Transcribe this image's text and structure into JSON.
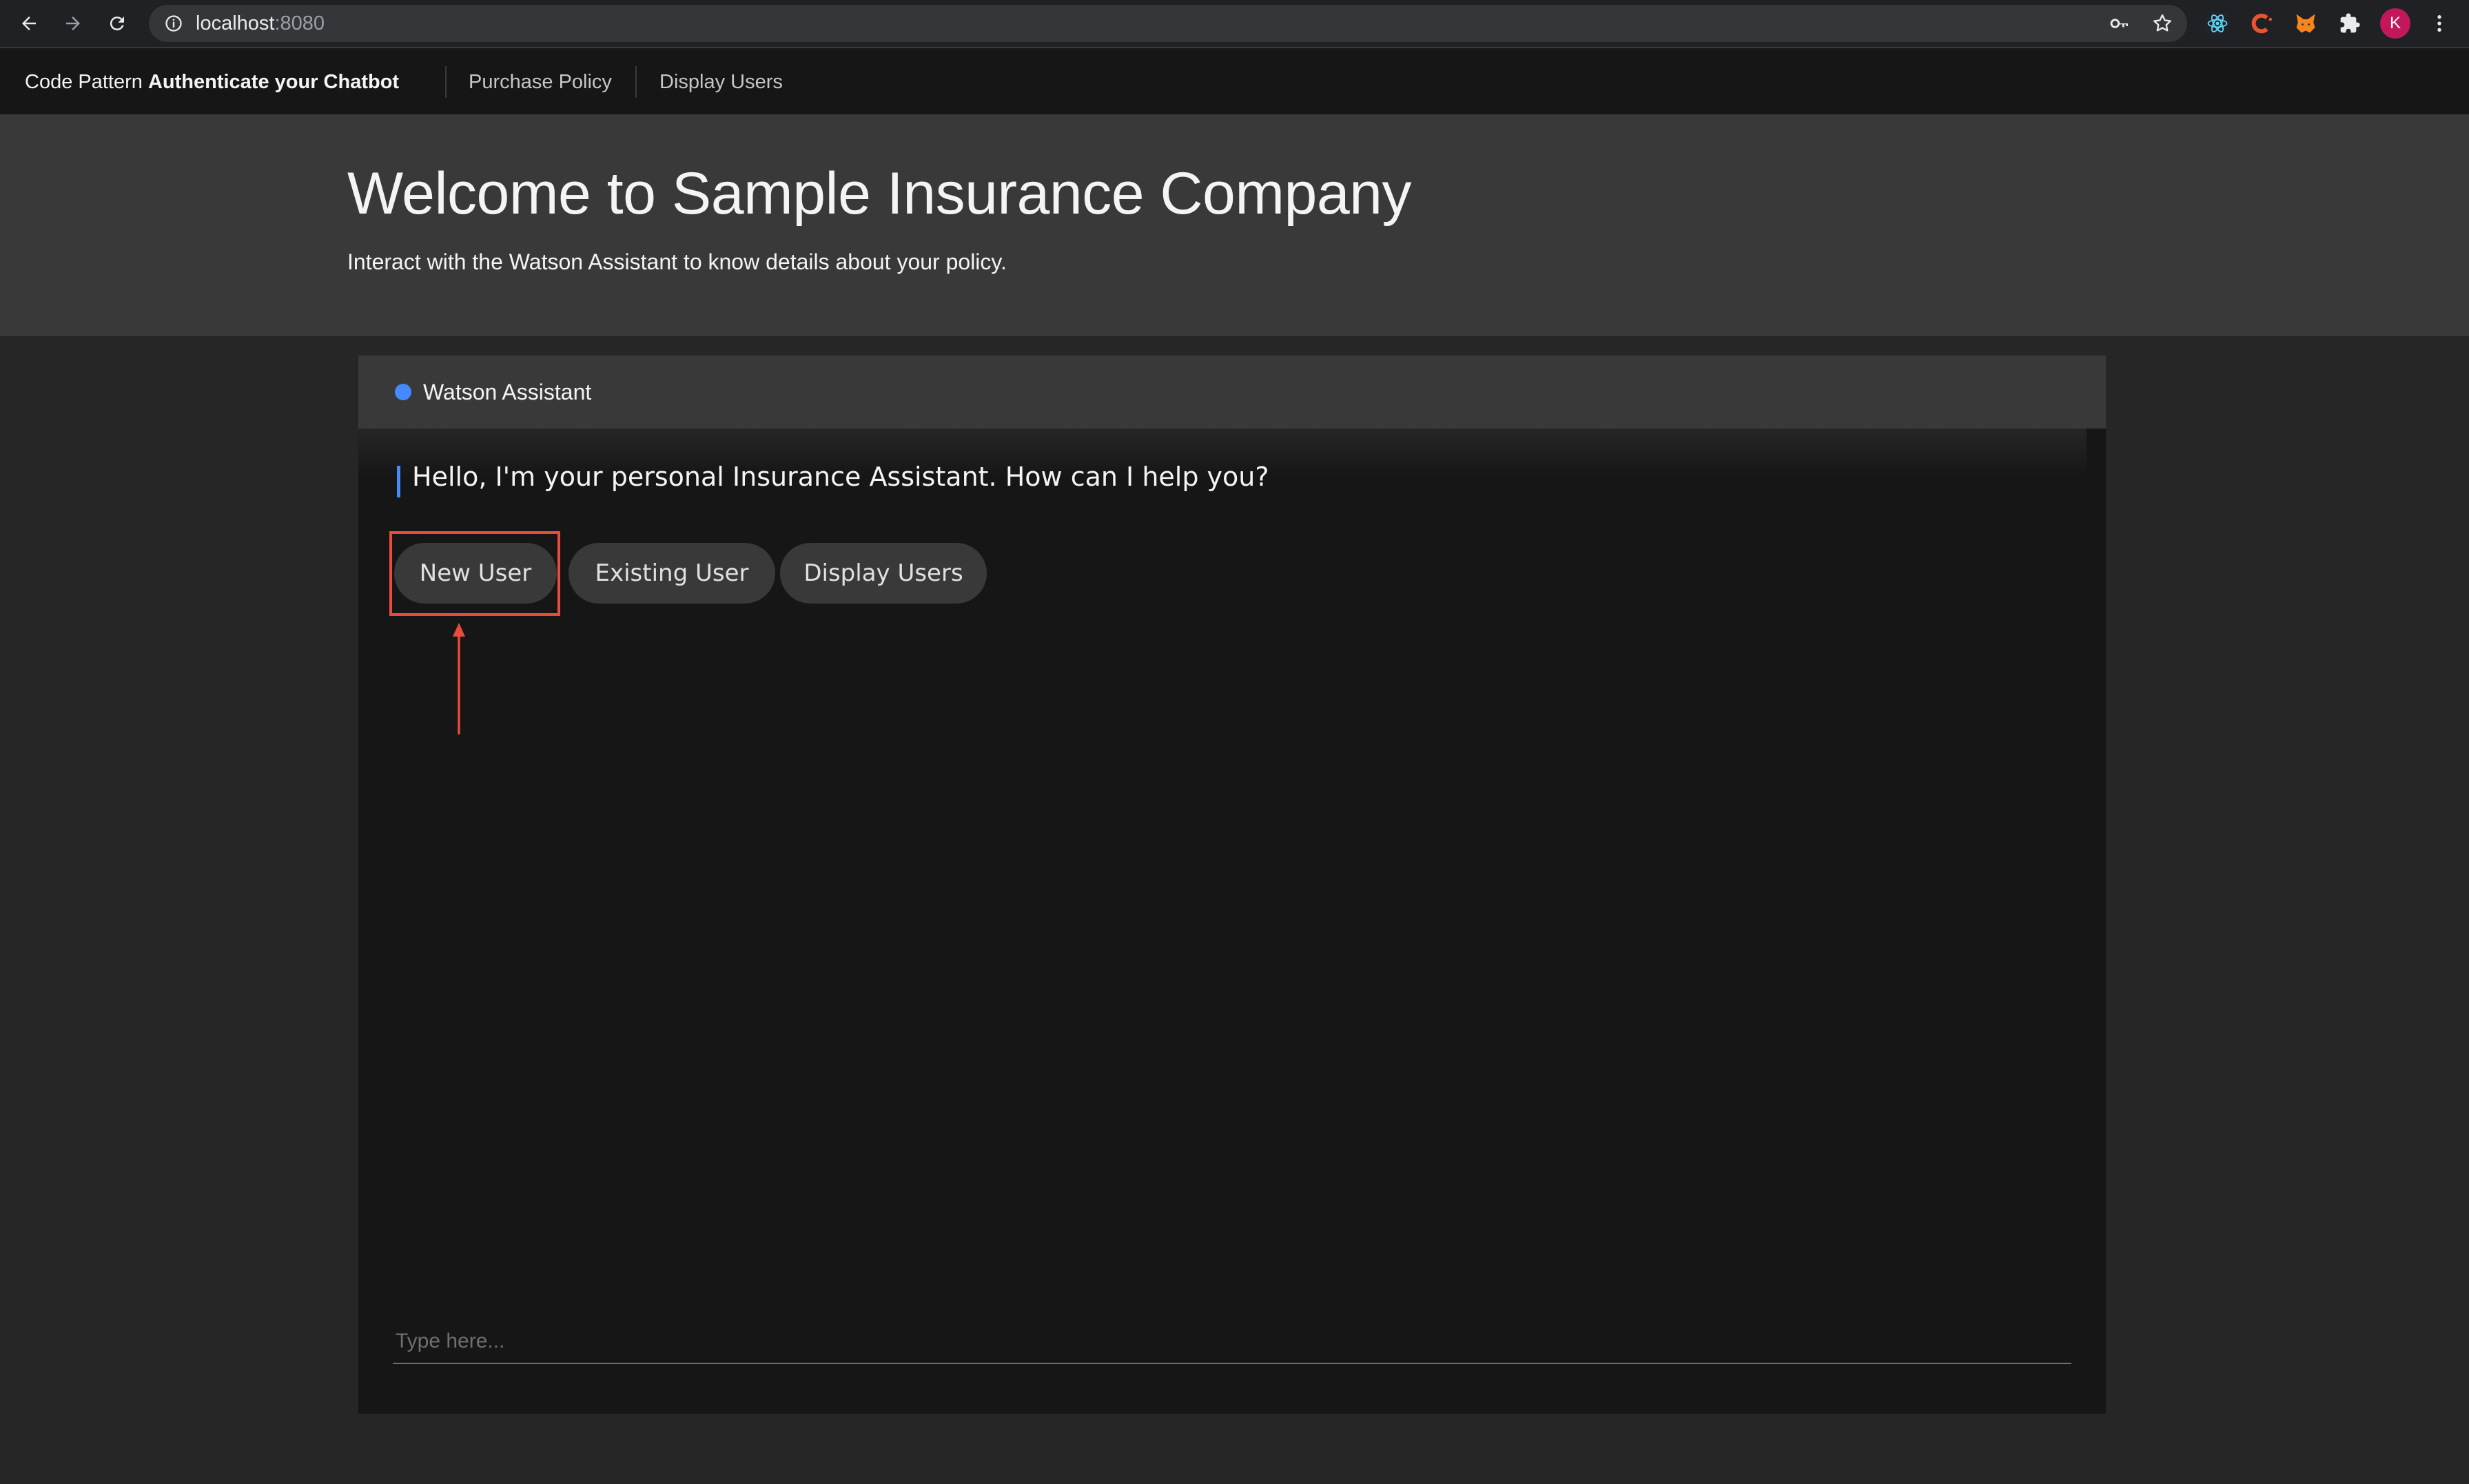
{
  "browser": {
    "url_host": "localhost",
    "url_port": ":8080",
    "profile_initial": "K"
  },
  "header": {
    "brand_prefix": "Code Pattern ",
    "brand_bold": "Authenticate your Chatbot",
    "links": [
      "Purchase Policy",
      "Display Users"
    ]
  },
  "hero": {
    "title": "Welcome to Sample Insurance Company",
    "subtitle": "Interact with the Watson Assistant to know details about your policy."
  },
  "chat": {
    "title": "Watson Assistant",
    "message": "Hello, I'm your personal Insurance Assistant. How can I help you?",
    "options": [
      "New User",
      "Existing User",
      "Display Users"
    ],
    "input_placeholder": "Type here..."
  },
  "colors": {
    "accent": "#4589ff",
    "annotation": "#e74c3c"
  }
}
